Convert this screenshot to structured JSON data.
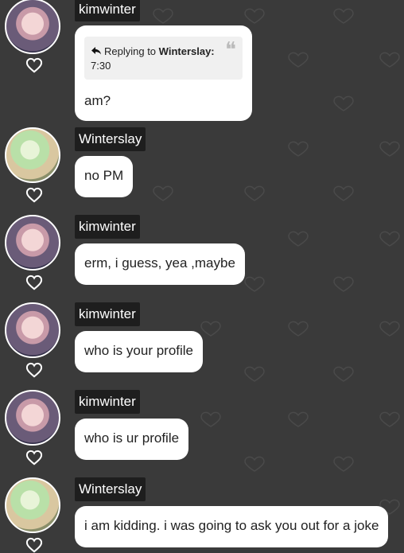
{
  "colors": {
    "background": "#3a3a3a",
    "bubble": "#ffffff",
    "username_bg": "#1e1e1e",
    "heart_outline": "#ffffff"
  },
  "messages": [
    {
      "username": "kimwinter",
      "reply": {
        "prefix": "Replying to",
        "target": "Winterslay:",
        "quoted": "7:30"
      },
      "text": "am?"
    },
    {
      "username": "Winterslay",
      "text": "no PM"
    },
    {
      "username": "kimwinter",
      "text": "erm, i guess, yea ,maybe"
    },
    {
      "username": "kimwinter",
      "text": "who is your profile"
    },
    {
      "username": "kimwinter",
      "text": "who is ur profile"
    },
    {
      "username": "Winterslay",
      "text": "i am kidding. i was going to ask you out for a joke"
    }
  ],
  "icons": {
    "like": "heart-outline-icon",
    "reply": "reply-arrow-icon",
    "quote": "quote-mark-icon"
  }
}
